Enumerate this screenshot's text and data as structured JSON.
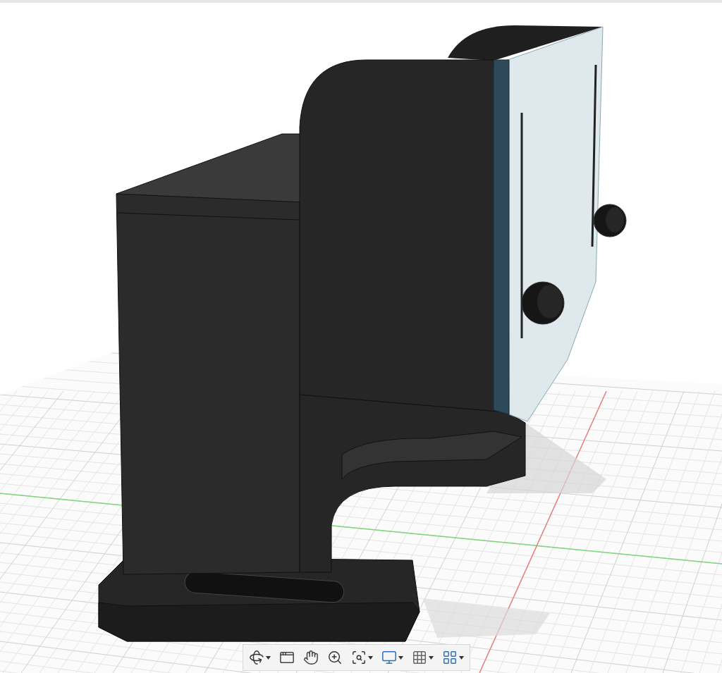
{
  "viewport": {
    "toolbar": {
      "tools": [
        {
          "kind": "orbit",
          "dropdown": true
        },
        {
          "kind": "look_at",
          "dropdown": false
        },
        {
          "kind": "pan",
          "dropdown": false
        },
        {
          "kind": "zoom",
          "dropdown": false
        },
        {
          "kind": "fit",
          "dropdown": true
        },
        {
          "kind": "display",
          "dropdown": true
        },
        {
          "kind": "grid",
          "dropdown": true
        },
        {
          "kind": "viewports",
          "dropdown": true
        }
      ]
    }
  }
}
